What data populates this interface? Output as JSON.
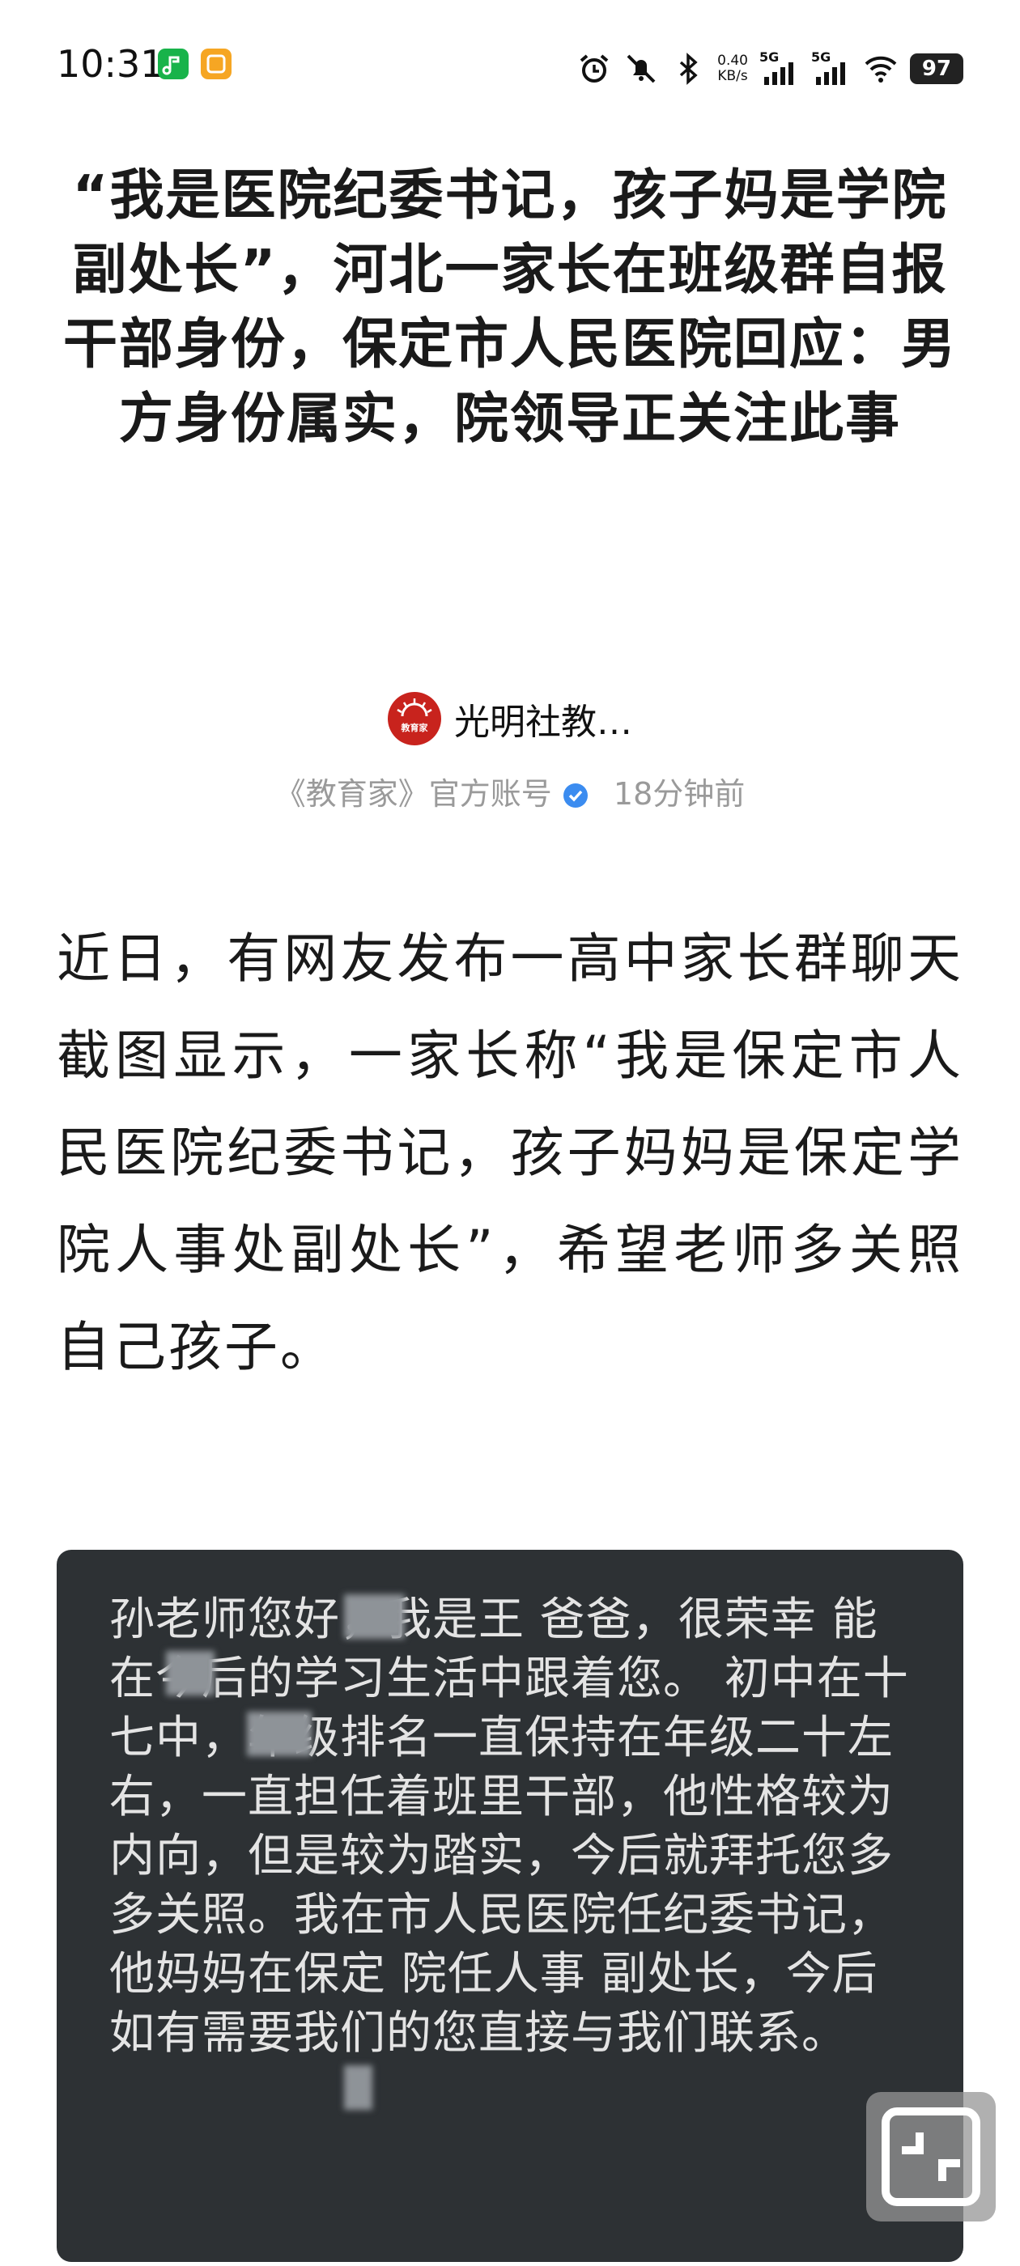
{
  "status_bar": {
    "time": "10:31",
    "net_speed_value": "0.40",
    "net_speed_unit": "KB/s",
    "signal_1_label": "5G",
    "signal_2_label": "5G",
    "battery_level": "97",
    "icons": [
      "alarm-icon",
      "mute-icon",
      "bluetooth-icon",
      "signal-icon",
      "wifi-icon"
    ]
  },
  "article": {
    "title": "“我是医院纪委书记，孩子妈是学院副处长”，河北一家长在班级群自报干部身份，保定市人民医院回应：男方身份属实，院领导正关注此事",
    "author": {
      "avatar_text": "教育家",
      "name": "光明社教…",
      "subtitle": "《教育家》官方账号",
      "time_ago": "18分钟前"
    },
    "body": "近日，有网友发布一高中家长群聊天截图显示，一家长称“我是保定市人民医院纪委书记，孩子妈妈是保定学院人事处副处长”，希望老师多关照自己孩子。",
    "image": {
      "chat_text": "孙老师您好，我是王  爸爸，很荣幸  能在今后的学习生活中跟着您。  初中在十七中，年级排名一直保持在年级二十左右，一直担任着班里干部，他性格较为内向，但是较为踏实，今后就拜托您多多关照。我在市人民医院任纪委书记，他妈妈在保定 院任人事 副处长，今后如有需要我们的您直接与我们联系。"
    }
  },
  "colors": {
    "avatar_bg": "#c8231d",
    "verify_blue": "#3b8cf0",
    "meta_gray": "#9a9a9a",
    "image_bg": "#2d3134"
  }
}
